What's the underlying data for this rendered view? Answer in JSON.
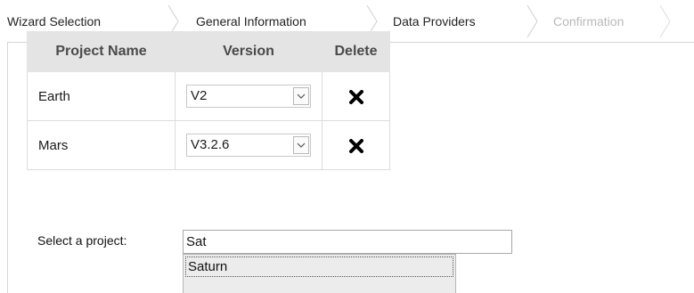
{
  "wizard": {
    "steps": [
      {
        "label": "Wizard Selection",
        "state": "done"
      },
      {
        "label": "General Information",
        "state": "done"
      },
      {
        "label": "Data Providers",
        "state": "current"
      },
      {
        "label": "Confirmation",
        "state": "disabled"
      }
    ]
  },
  "table": {
    "headers": {
      "name": "Project Name",
      "version": "Version",
      "delete": "Delete"
    },
    "rows": [
      {
        "name": "Earth",
        "version": "V2",
        "delete_icon": "x-delete-icon"
      },
      {
        "name": "Mars",
        "version": "V3.2.6",
        "delete_icon": "x-delete-icon"
      }
    ]
  },
  "select_project": {
    "label": "Select a project:",
    "value": "Sat",
    "suggestions": [
      "Saturn"
    ]
  },
  "colors": {
    "header_bg": "#e4e4e4",
    "disabled_text": "#b9b9b9",
    "suggest_bg": "#ececec"
  }
}
